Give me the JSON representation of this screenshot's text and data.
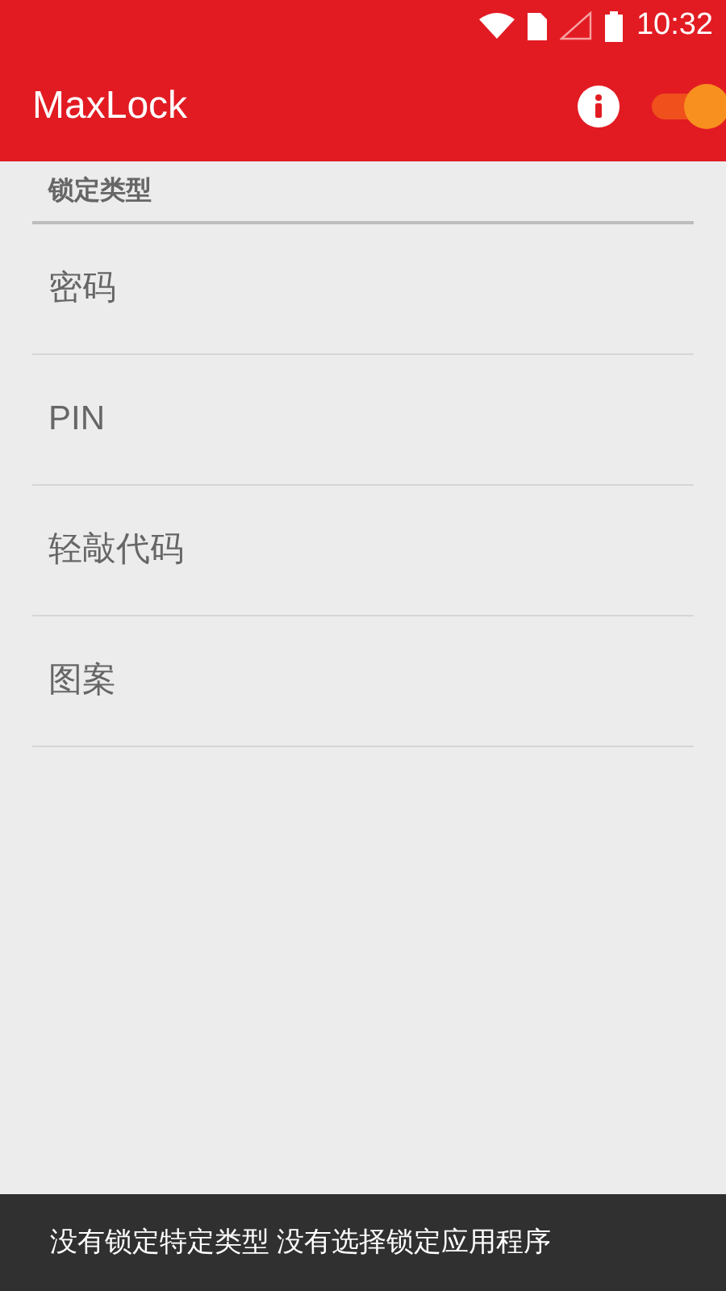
{
  "status_bar": {
    "time": "10:32"
  },
  "app_bar": {
    "title": "MaxLock",
    "master_switch": {
      "on": true
    }
  },
  "section": {
    "title": "锁定类型"
  },
  "items": [
    {
      "label": "密码"
    },
    {
      "label": "PIN"
    },
    {
      "label": "轻敲代码"
    },
    {
      "label": "图案"
    }
  ],
  "snackbar": {
    "message": "没有锁定特定类型 没有选择锁定应用程序"
  }
}
